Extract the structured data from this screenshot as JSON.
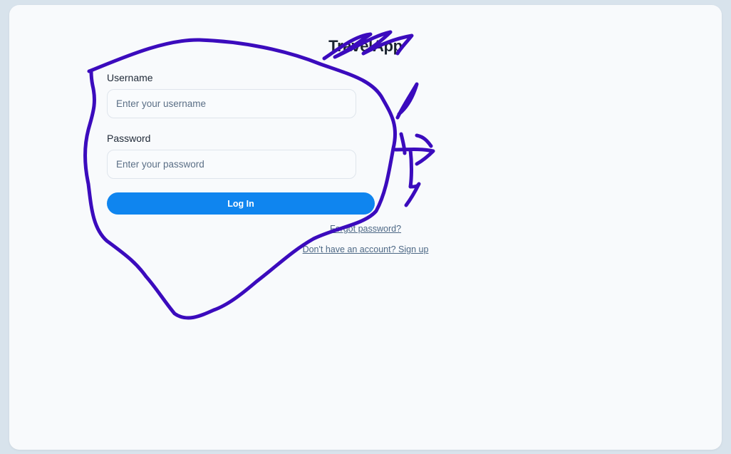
{
  "app": {
    "title": "TravelApp"
  },
  "form": {
    "username_label": "Username",
    "username_placeholder": "Enter your username",
    "username_value": "",
    "password_label": "Password",
    "password_placeholder": "Enter your password",
    "password_value": "",
    "login_label": "Log In"
  },
  "links": {
    "forgot_password": "Forgot password?",
    "signup": "Don't have an account? Sign up"
  },
  "colors": {
    "primary": "#0f85ef",
    "page_background": "#d8e3ec",
    "card_background": "#f8fafc",
    "annotation_ink": "#3b0bbd"
  }
}
